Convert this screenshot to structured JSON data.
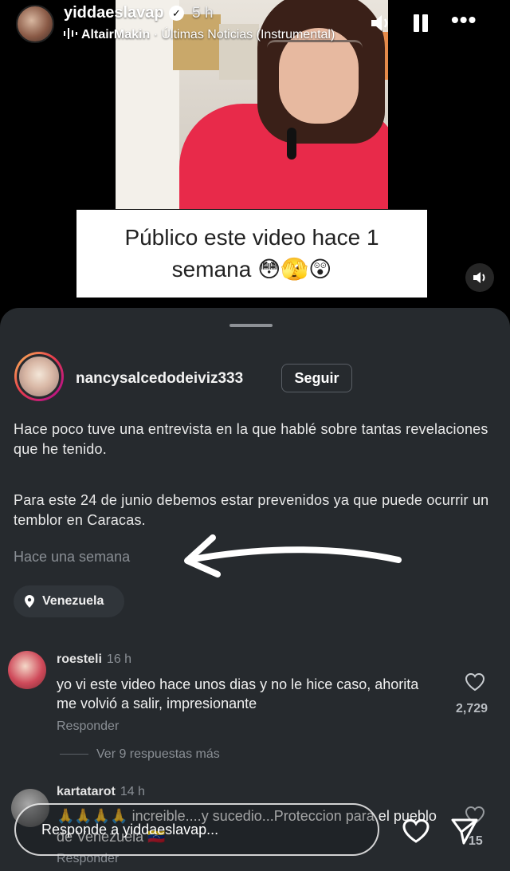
{
  "story": {
    "username": "yiddaeslavap",
    "time": "5 h",
    "music_artist": "AltairMakin",
    "music_separator": "·",
    "music_title": "Últimas Noticias (Instrumental)",
    "caption_line1": "Público este video hace 1",
    "caption_line2": "semana 😳🫣😲"
  },
  "post": {
    "username": "nancysalcedodeiviz333",
    "follow_label": "Seguir",
    "description_1": "Hace poco tuve una entrevista en la que hablé sobre  tantas revelaciones que he tenido.",
    "description_2": "Para este 24 de junio debemos estar prevenidos ya que puede ocurrir un temblor en Caracas.",
    "time": "Hace una semana",
    "location": "Venezuela"
  },
  "comments": [
    {
      "user": "roesteli",
      "time": "16 h",
      "text": "yo vi este video hace unos dias y no le hice caso, ahorita me volvió a salir, impresionante",
      "reply_label": "Responder",
      "likes": "2,729"
    },
    {
      "user": "kartatarot",
      "time": "14 h",
      "text": "🙏🙏🙏🙏 increible....y sucedio...Proteccion para el pueblo de Venezuela 🇻🇪",
      "reply_label": "Responder",
      "likes": "15"
    }
  ],
  "more_replies": "Ver 9 respuestas más",
  "reply_bar": {
    "placeholder": "Responde a yiddaeslavap..."
  },
  "colors": {
    "sheet_bg": "#262a2e",
    "caption_bg": "#ffffff",
    "text_muted": "#8a8f95"
  },
  "icons": {
    "verified": "verified-badge-icon",
    "sound": "speaker-icon",
    "pause": "pause-icon",
    "more": "more-dots-icon",
    "pin": "location-pin-icon",
    "heart": "heart-icon",
    "send": "send-icon"
  }
}
